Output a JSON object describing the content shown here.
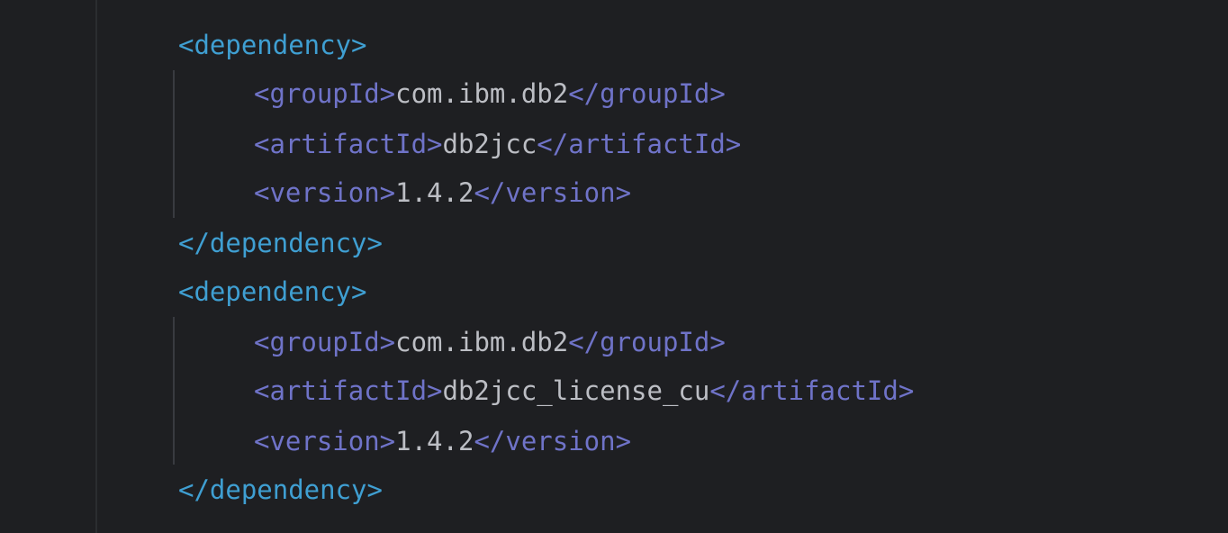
{
  "colors": {
    "background": "#1e1f22",
    "dependency_tag": "#3f9fd2",
    "inner_tag": "#6f73c8",
    "text_value": "#bcbec4",
    "indent_guide": "#393b40"
  },
  "code": {
    "dependencies": [
      {
        "open_tag": "<dependency>",
        "groupId": {
          "open": "<groupId>",
          "value": "com.ibm.db2",
          "close": "</groupId>"
        },
        "artifactId": {
          "open": "<artifactId>",
          "value": "db2jcc",
          "close": "</artifactId>"
        },
        "version": {
          "open": "<version>",
          "value": "1.4.2",
          "close": "</version>"
        },
        "close_tag": "</dependency>"
      },
      {
        "open_tag": "<dependency>",
        "groupId": {
          "open": "<groupId>",
          "value": "com.ibm.db2",
          "close": "</groupId>"
        },
        "artifactId": {
          "open": "<artifactId>",
          "value": "db2jcc_license_cu",
          "close": "</artifactId>"
        },
        "version": {
          "open": "<version>",
          "value": "1.4.2",
          "close": "</version>"
        },
        "close_tag": "</dependency>"
      }
    ]
  }
}
